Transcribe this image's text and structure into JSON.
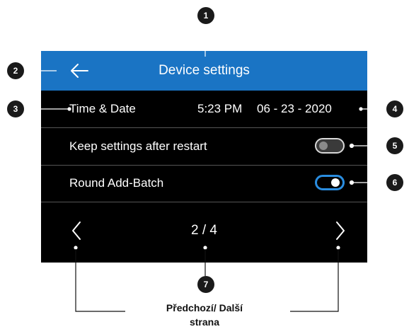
{
  "header": {
    "title": "Device settings",
    "back_icon": "arrow-left-icon"
  },
  "rows": [
    {
      "label": "Time & Date",
      "time": "5:23 PM",
      "date": "06 - 23 - 2020"
    },
    {
      "label": "Keep settings after restart",
      "toggle": "off"
    },
    {
      "label": "Round Add-Batch",
      "toggle": "on"
    }
  ],
  "pager": {
    "page": "2 / 4",
    "prev_icon": "chevron-left-icon",
    "next_icon": "chevron-right-icon"
  },
  "callouts": [
    "1",
    "2",
    "3",
    "4",
    "5",
    "6",
    "7"
  ],
  "caption": {
    "line1": "Předchozí/ Další",
    "line2": "strana"
  },
  "colors": {
    "header": "#1a74c4",
    "screen": "#000000",
    "toggle_on": "#2a8de0",
    "toggle_off": "#3a3a3a"
  }
}
